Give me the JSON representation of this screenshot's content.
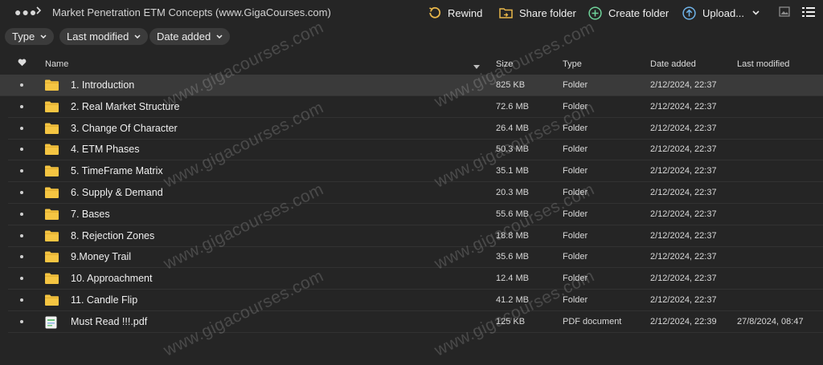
{
  "topbar": {
    "breadcrumb": "Market Penetration ETM Concepts (www.GigaCourses.com)",
    "rewind": "Rewind",
    "share": "Share folder",
    "create": "Create folder",
    "upload": "Upload..."
  },
  "filters": {
    "type": "Type",
    "last_modified": "Last modified",
    "date_added": "Date added"
  },
  "columns": {
    "name": "Name",
    "size": "Size",
    "type": "Type",
    "date_added": "Date added",
    "last_modified": "Last modified"
  },
  "rows": [
    {
      "name": "1. Introduction",
      "size": "825 KB",
      "type": "Folder",
      "added": "2/12/2024, 22:37",
      "modified": ""
    },
    {
      "name": "2. Real Market Structure",
      "size": "72.6 MB",
      "type": "Folder",
      "added": "2/12/2024, 22:37",
      "modified": ""
    },
    {
      "name": "3. Change Of Character",
      "size": "26.4 MB",
      "type": "Folder",
      "added": "2/12/2024, 22:37",
      "modified": ""
    },
    {
      "name": "4. ETM Phases",
      "size": "50.3 MB",
      "type": "Folder",
      "added": "2/12/2024, 22:37",
      "modified": ""
    },
    {
      "name": "5. TimeFrame Matrix",
      "size": "35.1 MB",
      "type": "Folder",
      "added": "2/12/2024, 22:37",
      "modified": ""
    },
    {
      "name": "6. Supply & Demand",
      "size": "20.3 MB",
      "type": "Folder",
      "added": "2/12/2024, 22:37",
      "modified": ""
    },
    {
      "name": "7. Bases",
      "size": "55.6 MB",
      "type": "Folder",
      "added": "2/12/2024, 22:37",
      "modified": ""
    },
    {
      "name": "8. Rejection Zones",
      "size": "18.8 MB",
      "type": "Folder",
      "added": "2/12/2024, 22:37",
      "modified": ""
    },
    {
      "name": "9.Money Trail",
      "size": "35.6 MB",
      "type": "Folder",
      "added": "2/12/2024, 22:37",
      "modified": ""
    },
    {
      "name": "10. Approachment",
      "size": "12.4 MB",
      "type": "Folder",
      "added": "2/12/2024, 22:37",
      "modified": ""
    },
    {
      "name": "11. Candle Flip",
      "size": "41.2 MB",
      "type": "Folder",
      "added": "2/12/2024, 22:37",
      "modified": ""
    },
    {
      "name": "Must Read !!!.pdf",
      "size": "125 KB",
      "type": "PDF document",
      "added": "2/12/2024, 22:39",
      "modified": "27/8/2024, 08:47"
    }
  ],
  "watermark": "www.gigacourses.com",
  "colors": {
    "background": "#252525",
    "selected_row": "#3a3a3a",
    "folder": "#f5c542",
    "rewind_icon": "#e8b64a",
    "create_icon": "#6fd39a",
    "upload_icon": "#6fb3e8"
  }
}
